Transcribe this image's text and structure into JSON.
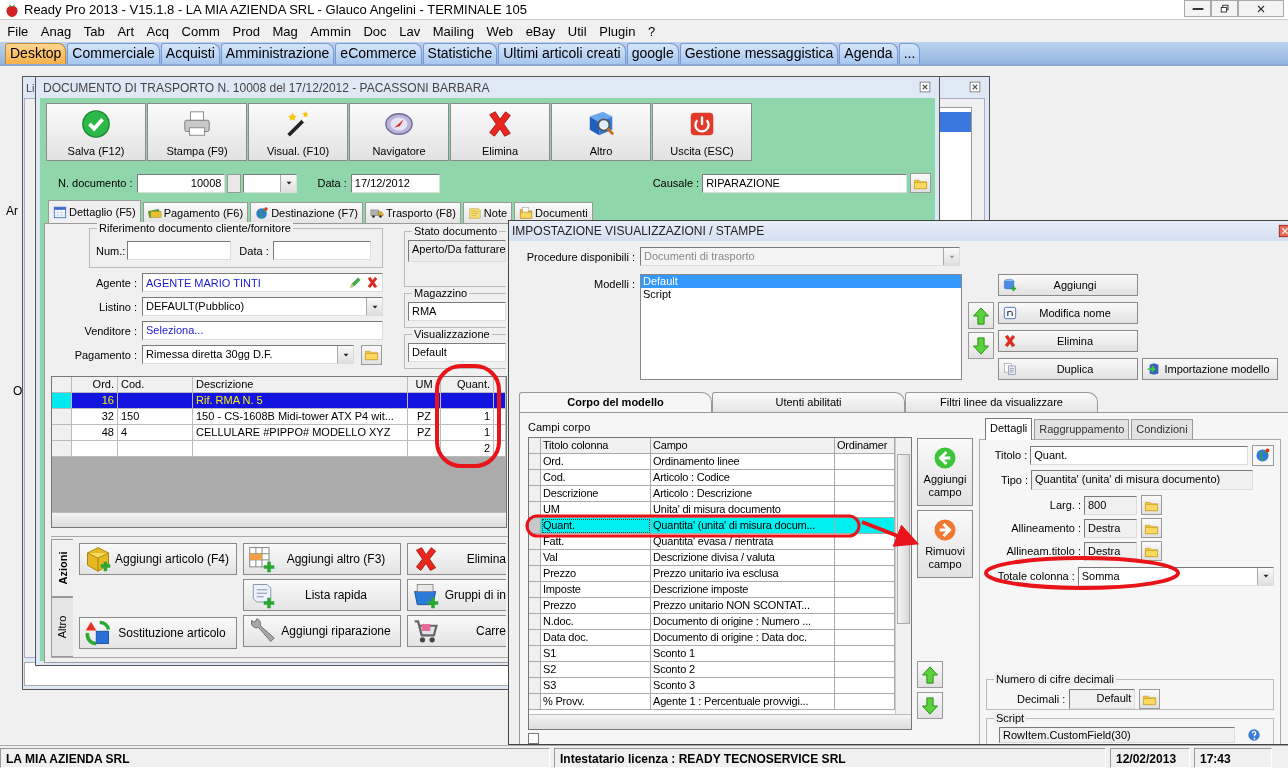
{
  "app_window": {
    "title": "Ready Pro 2013 - V15.1.8 - LA MIA AZIENDA SRL - Glauco Angelini - TERMINALE 105"
  },
  "menu": [
    "File",
    "Anag",
    "Tab",
    "Art",
    "Acq",
    "Comm",
    "Prod",
    "Mag",
    "Ammin",
    "Doc",
    "Lav",
    "Mailing",
    "Web",
    "eBay",
    "Util",
    "Plugin",
    "?"
  ],
  "desktop_tabs": [
    {
      "label": "Desktop",
      "selected": true
    },
    {
      "label": "Commerciale",
      "selected": false
    },
    {
      "label": "Acquisti",
      "selected": false
    },
    {
      "label": "Amministrazione",
      "selected": false
    },
    {
      "label": "eCommerce",
      "selected": false
    },
    {
      "label": "Statistiche",
      "selected": false
    },
    {
      "label": "Ultimi articoli creati",
      "selected": false
    },
    {
      "label": "google",
      "selected": false
    },
    {
      "label": "Gestione messaggistica",
      "selected": false
    },
    {
      "label": "Agenda",
      "selected": false
    },
    {
      "label": "...",
      "selected": false
    }
  ],
  "behind_labels": [
    "Ar",
    "O"
  ],
  "list_window": {
    "title": "Li"
  },
  "document_window": {
    "title": "DOCUMENTO DI TRASPORTO N. 10008 del 17/12/2012 - PACASSONI BARBARA",
    "toolbar": [
      {
        "label": "Salva (F12)",
        "kind": "save"
      },
      {
        "label": "Stampa (F9)",
        "kind": "print"
      },
      {
        "label": "Visual. (F10)",
        "kind": "display"
      },
      {
        "label": "Navigatore",
        "kind": "navigator"
      },
      {
        "label": "Elimina",
        "kind": "delete"
      },
      {
        "label": "Altro",
        "kind": "other"
      },
      {
        "label": "Uscita (ESC)",
        "kind": "exit"
      }
    ],
    "numero_label": "N. documento :",
    "numero": "10008",
    "data_label": "Data :",
    "data": "17/12/2012",
    "causale_label": "Causale :",
    "causale": "RIPARAZIONE",
    "tabs": [
      {
        "label": "Dettaglio (F5)",
        "kind": "calendar",
        "selected": true
      },
      {
        "label": "Pagamento (F6)",
        "kind": "money",
        "selected": false
      },
      {
        "label": "Destinazione (F7)",
        "kind": "globe",
        "selected": false
      },
      {
        "label": "Trasporto (F8)",
        "kind": "truck",
        "selected": false
      },
      {
        "label": "Note",
        "kind": "note",
        "selected": false
      },
      {
        "label": "Documenti",
        "kind": "docs",
        "selected": false
      }
    ],
    "riferimento": {
      "legend": "Riferimento documento cliente/fornitore",
      "num_label": "Num.:",
      "data_label": "Data :"
    },
    "fields": [
      {
        "label": "Agente :",
        "value": "AGENTE MARIO TINTI",
        "kind": "agent"
      },
      {
        "label": "Listino :",
        "value": "DEFAULT(Pubblico)",
        "kind": "combo"
      },
      {
        "label": "Venditore :",
        "value": "Seleziona...",
        "kind": "link"
      },
      {
        "label": "Pagamento :",
        "value": "Rimessa diretta 30gg D.F.",
        "kind": "combo_folder"
      }
    ],
    "stato": {
      "legend": "Stato documento",
      "value": "Aperto/Da fatturare"
    },
    "magazzino": {
      "legend": "Magazzino",
      "value": "RMA"
    },
    "visualizzazione": {
      "legend": "Visualizzazione",
      "value": "Default"
    },
    "grid": {
      "columns": [
        "Ord.",
        "Cod.",
        "Descrizione",
        "UM",
        "Quant."
      ],
      "rows": [
        {
          "cells": [
            "16",
            "",
            "Rif. RMA N. 5",
            "",
            ""
          ],
          "selected": true
        },
        {
          "cells": [
            "32",
            "150",
            "150 - CS-1608B Midi-tower ATX P4 wit...",
            "PZ",
            "1"
          ],
          "selected": false
        },
        {
          "cells": [
            "48",
            "4",
            "CELLULARE #PIPPO# MODELLO XYZ",
            "PZ",
            "1"
          ],
          "selected": false
        },
        {
          "cells": [
            "",
            "",
            "",
            "",
            "2"
          ],
          "selected": false
        }
      ]
    },
    "side_tabs": [
      {
        "label": "Azioni",
        "selected": true
      },
      {
        "label": "Altro",
        "selected": false
      }
    ],
    "action_columns": [
      [
        {
          "label": "Aggiungi articolo (F4)",
          "kind": "cube"
        },
        {
          "label": "Sostituzione articolo",
          "kind": "replace"
        }
      ],
      [
        {
          "label": "Aggiungi altro (F3)",
          "kind": "gridplus"
        },
        {
          "label": "Lista rapida",
          "kind": "scroll"
        },
        {
          "label": "Aggiungi riparazione",
          "kind": "wrench"
        }
      ],
      [
        {
          "label": "Elimina",
          "kind": "delete"
        },
        {
          "label": "Gruppi di in",
          "kind": "basket"
        },
        {
          "label": "Carre",
          "kind": "cart"
        }
      ]
    ]
  },
  "settings_dialog": {
    "title": "IMPOSTAZIONE VISUALIZZAZIONI / STAMPE",
    "procedure_label": "Procedure disponibili :",
    "procedure": "Documenti di trasporto",
    "procedure_disabled": true,
    "modelli_label": "Modelli :",
    "modelli": [
      {
        "label": "Default",
        "selected": true
      },
      {
        "label": "Script",
        "selected": false
      }
    ],
    "model_buttons": [
      {
        "label": "Aggiungi",
        "kind": "add"
      },
      {
        "label": "Modifica nome",
        "kind": "rename"
      },
      {
        "label": "Elimina",
        "kind": "delete"
      },
      {
        "label": "Duplica",
        "kind": "copy"
      }
    ],
    "import_button": "Importazione modello",
    "tabs": [
      {
        "label": "Corpo del modello",
        "selected": true
      },
      {
        "label": "Utenti abilitati",
        "selected": false
      },
      {
        "label": "Filtri linee da visualizzare",
        "selected": false
      }
    ],
    "campi_label": "Campi corpo",
    "fields_grid": {
      "columns": [
        "Titolo colonna",
        "Campo",
        "Ordinamer"
      ],
      "rows": [
        {
          "cells": [
            "Ord.",
            "Ordinamento linee"
          ],
          "selected": false
        },
        {
          "cells": [
            "Cod.",
            "Articolo : Codice"
          ],
          "selected": false
        },
        {
          "cells": [
            "Descrizione",
            "Articolo : Descrizione"
          ],
          "selected": false
        },
        {
          "cells": [
            "UM",
            "Unita' di misura documento"
          ],
          "selected": false
        },
        {
          "cells": [
            "Quant.",
            "Quantita' (unita' di misura docum..."
          ],
          "selected": true
        },
        {
          "cells": [
            "Fatt.",
            "Quantita' evasa / rientrata"
          ],
          "selected": false
        },
        {
          "cells": [
            "Val",
            "Descrizione divisa / valuta"
          ],
          "selected": false
        },
        {
          "cells": [
            "Prezzo",
            "Prezzo unitario iva esclusa"
          ],
          "selected": false
        },
        {
          "cells": [
            "Imposte",
            "Descrizione imposte"
          ],
          "selected": false
        },
        {
          "cells": [
            "Prezzo",
            "Prezzo unitario NON SCONTAT..."
          ],
          "selected": false
        },
        {
          "cells": [
            "N.doc.",
            "Documento di origine : Numero ..."
          ],
          "selected": false
        },
        {
          "cells": [
            "Data doc.",
            "Documento di origine : Data doc."
          ],
          "selected": false
        },
        {
          "cells": [
            "S1",
            "Sconto 1"
          ],
          "selected": false
        },
        {
          "cells": [
            "S2",
            "Sconto 2"
          ],
          "selected": false
        },
        {
          "cells": [
            "S3",
            "Sconto 3"
          ],
          "selected": false
        },
        {
          "cells": [
            "% Provv.",
            "Agente 1 : Percentuale provvigi..."
          ],
          "selected": false
        }
      ]
    },
    "add_field": "Aggiungi campo",
    "remove_field": "Rimuovi campo",
    "detail_tabs": [
      {
        "label": "Dettagli",
        "selected": true
      },
      {
        "label": "Raggruppamento",
        "selected": false
      },
      {
        "label": "Condizioni",
        "selected": false
      }
    ],
    "titolo_label": "Titolo :",
    "titolo": "Quant.",
    "tipo_label": "Tipo :",
    "tipo": "Quantita' (unita' di misura documento)",
    "props": [
      {
        "label": "Larg. :",
        "value": "800"
      },
      {
        "label": "Allineamento :",
        "value": "Destra"
      },
      {
        "label": "Allineam.titolo :",
        "value": "Destra"
      }
    ],
    "totale_label": "Totale colonna :",
    "totale": "Somma",
    "decimali_legend": "Numero di cifre decimali",
    "decimali_label": "Decimali :",
    "decimali": "Default",
    "script_legend": "Script",
    "script": "RowItem.CustomField(30)",
    "bottom_checkbox": {
      "checked": false
    }
  },
  "status_bar": [
    "LA MIA AZIENDA SRL",
    "Intestatario licenza : READY TECNOSERVICE SRL",
    "12/02/2013",
    "17:43"
  ]
}
